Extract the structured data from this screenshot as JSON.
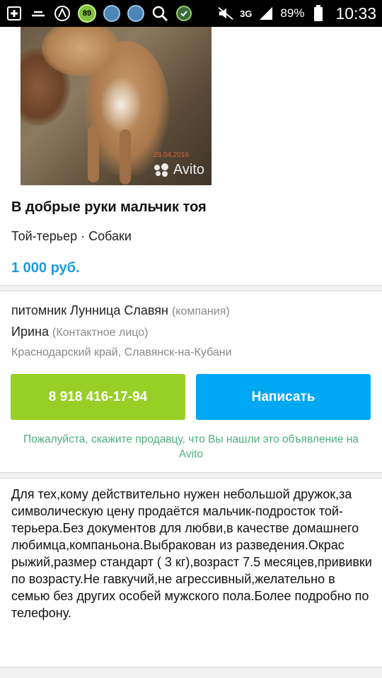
{
  "status_bar": {
    "icons_left": [
      "plus-icon",
      "minus-icon",
      "avast-icon",
      "badge-89",
      "app-icon",
      "app-icon",
      "search-icon",
      "shield-icon"
    ],
    "badge_value": "89",
    "network": "3G",
    "battery_percent": "89%",
    "time": "10:33"
  },
  "listing": {
    "photo_stamp": "28.04.2016",
    "watermark": "Avito",
    "title": "В добрые руки мальчик тоя",
    "category": "Той-терьер · Собаки",
    "price": "1 000 руб."
  },
  "seller": {
    "company_name": "питомник Лунница Славян",
    "company_tag": "(компания)",
    "contact_name": "Ирина",
    "contact_tag": "(Контактное лицо)",
    "location": "Краснодарский край, Славянск-на-Кубани",
    "call_button": "8 918 416-17-94",
    "write_button": "Написать",
    "notice": "Пожалуйста, скажите продавцу, что Вы нашли это объявление на Avito"
  },
  "description": {
    "text": "Для тех,кому действительно нужен небольшой дружок,за символическую цену продаётся мальчик-подросток той-терьера.Без документов для любви,в качестве домашнего любимца,компаньона.Выбракован из разведения.Окрас рыжий,размер стандарт ( 3 кг),возраст 7.5 месяцев,прививки по возрасту.Не гавкучий,не агрессивный,желательно в семью без других особей мужского пола.Более подробно по телефону."
  },
  "colors": {
    "price": "#1a9be0",
    "call_button": "#97cf26",
    "write_button": "#00a8f3",
    "notice": "#4caf82"
  }
}
